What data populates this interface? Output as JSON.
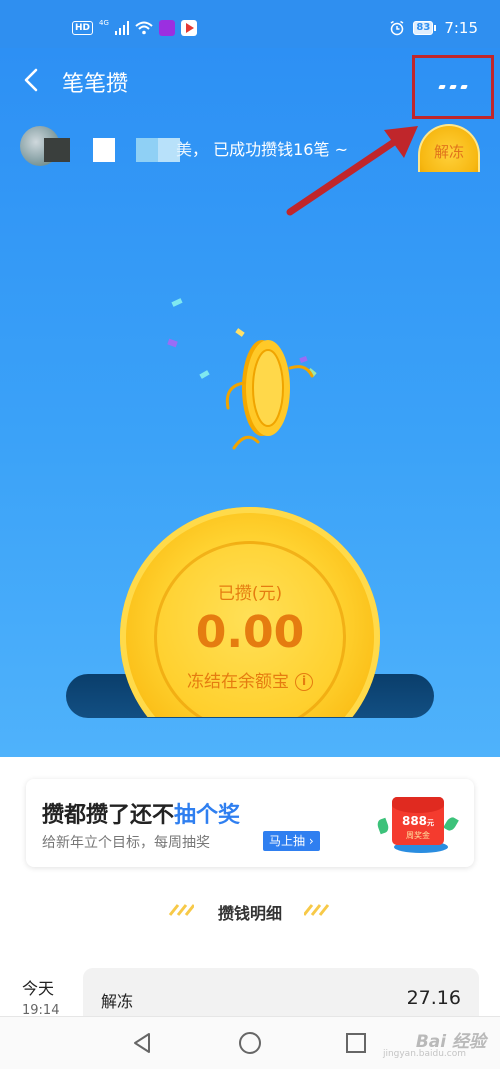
{
  "status_bar": {
    "network_badge": "HD",
    "network_type": "4G",
    "battery": "83",
    "time": "7:15"
  },
  "nav": {
    "title": "笔笔攒",
    "back_icon": "chevron-left-icon",
    "more_icon": "more-dots-icon"
  },
  "user": {
    "name_tail": "美",
    "comma": "，",
    "summary": "已成功攒钱16笔 ~"
  },
  "thaw_button_label": "解冻",
  "coin": {
    "saved_label": "已攒(元)",
    "amount": "0.00",
    "frozen_label": "冻结在余额宝",
    "info_icon_text": "i"
  },
  "promo": {
    "title_prefix": "攒都攒了还不",
    "title_highlight": "抽个奖",
    "subtitle": "给新年立个目标，每周抽奖",
    "button": "马上抽 ›",
    "redpacket_amount": "888",
    "redpacket_unit": "元",
    "redpacket_note": "周奖金"
  },
  "details": {
    "header": "攒钱明细",
    "records": [
      {
        "day": "今天",
        "time": "19:14",
        "type": "解冻",
        "amount": "27.16"
      }
    ]
  },
  "watermark": {
    "main": "Bai 经验",
    "sub": "jingyan.baidu.com"
  },
  "colors": {
    "primary_blue": "#2f8ff0",
    "coin_gold": "#ffd230",
    "coin_text": "#e57c10",
    "highlight_box": "#c0262b"
  }
}
